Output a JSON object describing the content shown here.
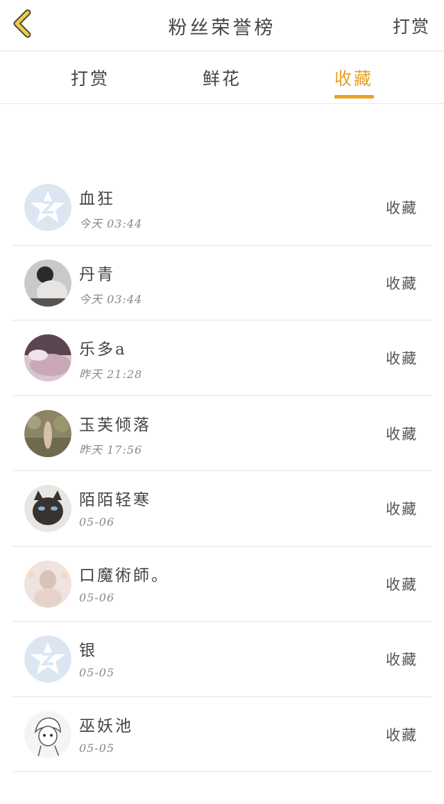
{
  "header": {
    "title": "粉丝荣誉榜",
    "right_action": "打赏"
  },
  "tabs": [
    {
      "label": "打赏"
    },
    {
      "label": "鲜花"
    },
    {
      "label": "收藏"
    }
  ],
  "active_tab": "收藏",
  "accent_color": "#e8a127",
  "list": [
    {
      "name": "血狂",
      "time": "今天 03:44",
      "action": "收藏",
      "avatar": "default-star-avatar"
    },
    {
      "name": "丹青",
      "time": "今天 03:44",
      "action": "收藏",
      "avatar": "photo-avatar"
    },
    {
      "name": "乐多a",
      "time": "昨天 21:28",
      "action": "收藏",
      "avatar": "photo-avatar"
    },
    {
      "name": "玉芙倾落",
      "time": "昨天 17:56",
      "action": "收藏",
      "avatar": "photo-avatar"
    },
    {
      "name": "陌陌轻寒",
      "time": "05-06",
      "action": "收藏",
      "avatar": "cat-photo-avatar"
    },
    {
      "name": "口魔術師。",
      "time": "05-06",
      "action": "收藏",
      "avatar": "photo-avatar"
    },
    {
      "name": "银",
      "time": "05-05",
      "action": "收藏",
      "avatar": "default-star-avatar"
    },
    {
      "name": "巫妖池",
      "time": "05-05",
      "action": "收藏",
      "avatar": "cartoon-avatar"
    }
  ]
}
